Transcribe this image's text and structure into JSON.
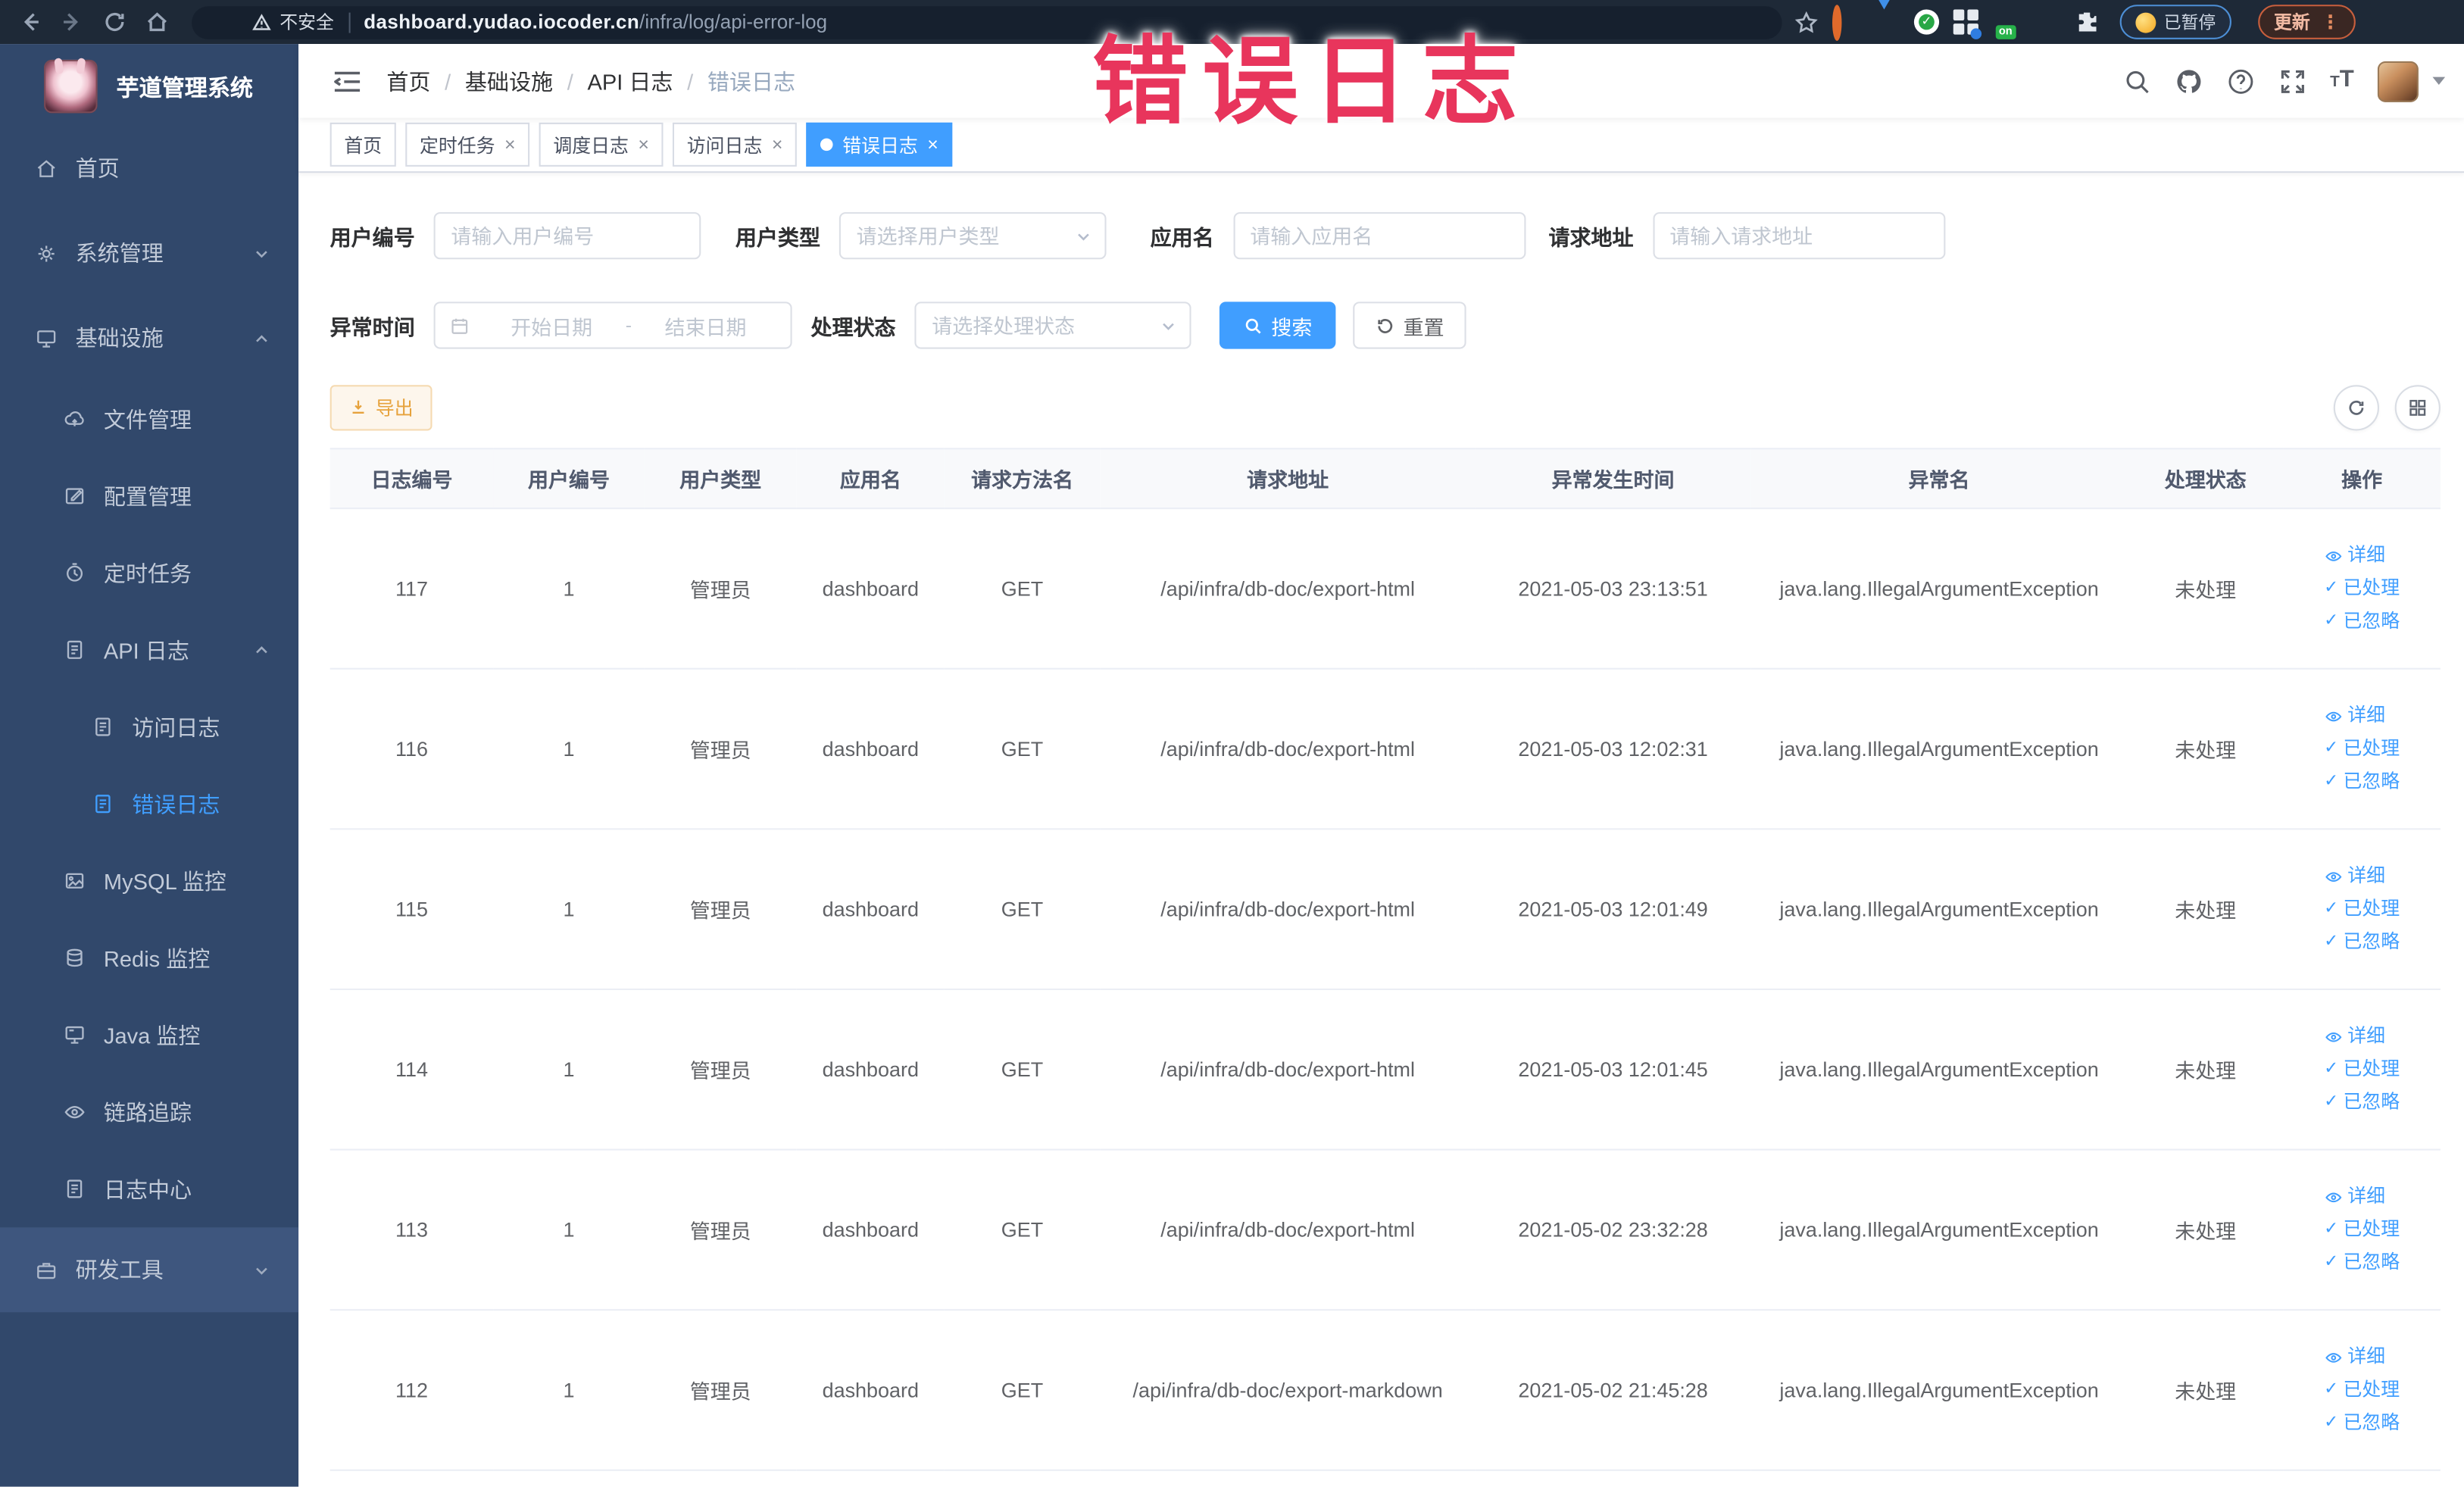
{
  "browser": {
    "security_label": "不安全",
    "url_host": "dashboard.yudao.iocoder.cn",
    "url_path": "/infra/log/api-error-log",
    "on_badge": "on",
    "paused_badge": "已暂停",
    "update_label": "更新"
  },
  "watermark": "错误日志",
  "icons": {
    "close": "×",
    "check": "✓",
    "menu_dots": "⋮"
  },
  "sidebar": {
    "title": "芋道管理系统",
    "items": [
      {
        "label": "首页"
      },
      {
        "label": "系统管理"
      },
      {
        "label": "基础设施"
      },
      {
        "label": "文件管理"
      },
      {
        "label": "配置管理"
      },
      {
        "label": "定时任务"
      },
      {
        "label": "API 日志"
      },
      {
        "label": "访问日志"
      },
      {
        "label": "错误日志"
      },
      {
        "label": "MySQL 监控"
      },
      {
        "label": "Redis 监控"
      },
      {
        "label": "Java 监控"
      },
      {
        "label": "链路追踪"
      },
      {
        "label": "日志中心"
      },
      {
        "label": "研发工具"
      }
    ]
  },
  "breadcrumb": {
    "items": [
      "首页",
      "基础设施",
      "API 日志",
      "错误日志"
    ],
    "separator": "/"
  },
  "tabs": [
    {
      "label": "首页"
    },
    {
      "label": "定时任务"
    },
    {
      "label": "调度日志"
    },
    {
      "label": "访问日志"
    },
    {
      "label": "错误日志"
    }
  ],
  "filters": {
    "user_id_label": "用户编号",
    "user_id_placeholder": "请输入用户编号",
    "user_type_label": "用户类型",
    "user_type_placeholder": "请选择用户类型",
    "app_name_label": "应用名",
    "app_name_placeholder": "请输入应用名",
    "request_url_label": "请求地址",
    "request_url_placeholder": "请输入请求地址",
    "time_label": "异常时间",
    "time_start_placeholder": "开始日期",
    "time_range_separator": "-",
    "time_end_placeholder": "结束日期",
    "status_label": "处理状态",
    "status_placeholder": "请选择处理状态",
    "search_label": "搜索",
    "reset_label": "重置"
  },
  "toolbar": {
    "export_label": "导出"
  },
  "table": {
    "headers": [
      "日志编号",
      "用户编号",
      "用户类型",
      "应用名",
      "请求方法名",
      "请求地址",
      "异常发生时间",
      "异常名",
      "处理状态",
      "操作"
    ],
    "actions": [
      "详细",
      "已处理",
      "已忽略"
    ],
    "rows": [
      {
        "id": "117",
        "user_id": "1",
        "user_type": "管理员",
        "app": "dashboard",
        "method": "GET",
        "url": "/api/infra/db-doc/export-html",
        "time": "2021-05-03 23:13:51",
        "exception": "java.lang.IllegalArgumentException",
        "status": "未处理"
      },
      {
        "id": "116",
        "user_id": "1",
        "user_type": "管理员",
        "app": "dashboard",
        "method": "GET",
        "url": "/api/infra/db-doc/export-html",
        "time": "2021-05-03 12:02:31",
        "exception": "java.lang.IllegalArgumentException",
        "status": "未处理"
      },
      {
        "id": "115",
        "user_id": "1",
        "user_type": "管理员",
        "app": "dashboard",
        "method": "GET",
        "url": "/api/infra/db-doc/export-html",
        "time": "2021-05-03 12:01:49",
        "exception": "java.lang.IllegalArgumentException",
        "status": "未处理"
      },
      {
        "id": "114",
        "user_id": "1",
        "user_type": "管理员",
        "app": "dashboard",
        "method": "GET",
        "url": "/api/infra/db-doc/export-html",
        "time": "2021-05-03 12:01:45",
        "exception": "java.lang.IllegalArgumentException",
        "status": "未处理"
      },
      {
        "id": "113",
        "user_id": "1",
        "user_type": "管理员",
        "app": "dashboard",
        "method": "GET",
        "url": "/api/infra/db-doc/export-html",
        "time": "2021-05-02 23:32:28",
        "exception": "java.lang.IllegalArgumentException",
        "status": "未处理"
      },
      {
        "id": "112",
        "user_id": "1",
        "user_type": "管理员",
        "app": "dashboard",
        "method": "GET",
        "url": "/api/infra/db-doc/export-markdown",
        "time": "2021-05-02 21:45:28",
        "exception": "java.lang.IllegalArgumentException",
        "status": "未处理"
      }
    ]
  },
  "colors": {
    "accent": "#409eff",
    "warning": "#e6a23c",
    "watermark": "#e8355c",
    "sidebar_bg": "#31486b"
  }
}
